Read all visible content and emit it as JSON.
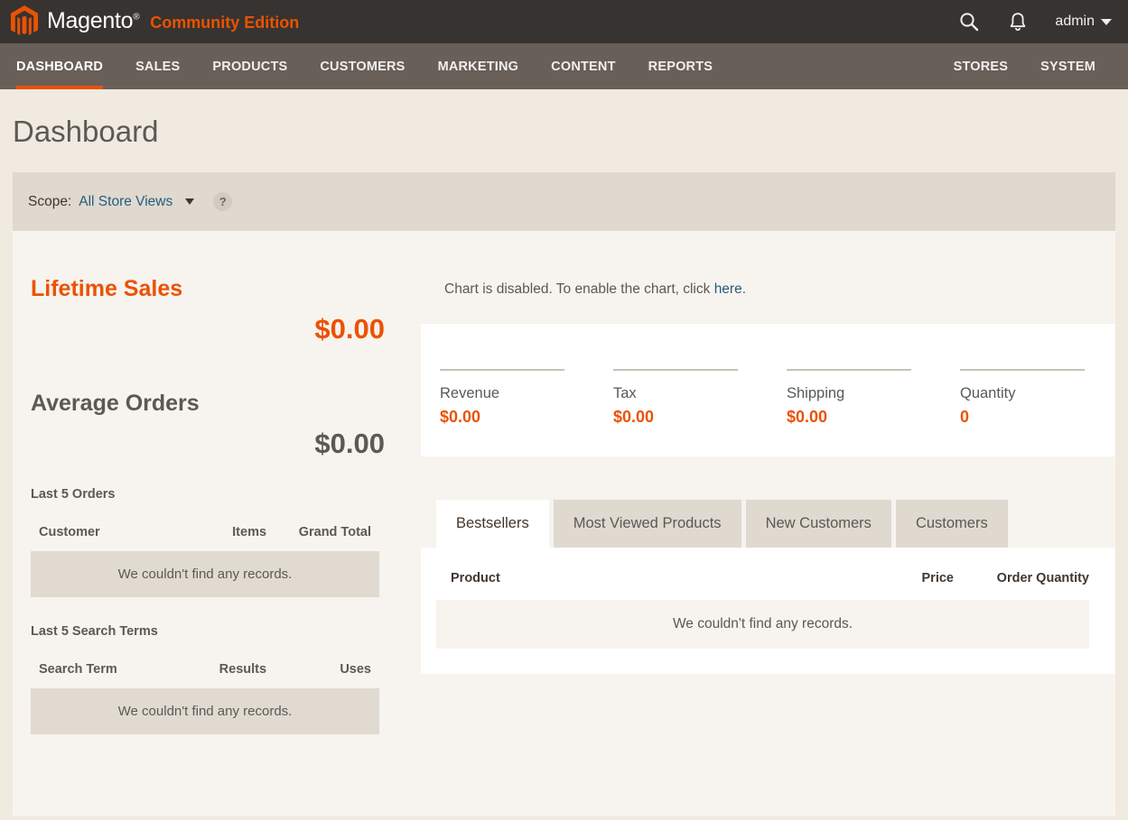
{
  "header": {
    "logo_text": "Magento",
    "logo_reg": "®",
    "edition": "Community Edition",
    "search_icon": "search-icon",
    "notifications_icon": "bell-icon",
    "user_label": "admin"
  },
  "nav": {
    "primary": [
      {
        "label": "DASHBOARD",
        "active": true
      },
      {
        "label": "SALES",
        "active": false
      },
      {
        "label": "PRODUCTS",
        "active": false
      },
      {
        "label": "CUSTOMERS",
        "active": false
      },
      {
        "label": "MARKETING",
        "active": false
      },
      {
        "label": "CONTENT",
        "active": false
      },
      {
        "label": "REPORTS",
        "active": false
      }
    ],
    "secondary": [
      {
        "label": "STORES"
      },
      {
        "label": "SYSTEM"
      }
    ]
  },
  "page": {
    "title": "Dashboard"
  },
  "scope": {
    "label": "Scope:",
    "value": "All Store Views",
    "help_icon": "question-mark-icon",
    "help_label": "?"
  },
  "sidebar": {
    "lifetime_sales": {
      "label": "Lifetime Sales",
      "value": "$0.00"
    },
    "average_orders": {
      "label": "Average Orders",
      "value": "$0.00"
    },
    "last_orders": {
      "title": "Last 5 Orders",
      "columns": [
        "Customer",
        "Items",
        "Grand Total"
      ],
      "empty_message": "We couldn't find any records.",
      "rows": []
    },
    "last_search_terms": {
      "title": "Last 5 Search Terms",
      "columns": [
        "Search Term",
        "Results",
        "Uses"
      ],
      "empty_message": "We couldn't find any records.",
      "rows": []
    }
  },
  "main": {
    "chart_notice": {
      "text_before": "Chart is disabled. To enable the chart, click ",
      "link_text": "here",
      "text_after": "."
    },
    "stats": [
      {
        "label": "Revenue",
        "value": "$0.00"
      },
      {
        "label": "Tax",
        "value": "$0.00"
      },
      {
        "label": "Shipping",
        "value": "$0.00"
      },
      {
        "label": "Quantity",
        "value": "0"
      }
    ],
    "tabs": [
      {
        "label": "Bestsellers",
        "active": true
      },
      {
        "label": "Most Viewed Products",
        "active": false
      },
      {
        "label": "New Customers",
        "active": false
      },
      {
        "label": "Customers",
        "active": false
      }
    ],
    "bestsellers": {
      "columns": [
        "Product",
        "Price",
        "Order Quantity"
      ],
      "empty_message": "We couldn't find any records.",
      "rows": []
    }
  },
  "colors": {
    "brand_orange": "#eb5202",
    "header_dark": "#373330",
    "nav_brown": "#685f59",
    "link_blue": "#275d7c",
    "page_bg": "#f0eae0",
    "panel_bg": "#f7f3ee",
    "scope_bg": "#dfd9d0",
    "text_gray": "#5b5955"
  }
}
